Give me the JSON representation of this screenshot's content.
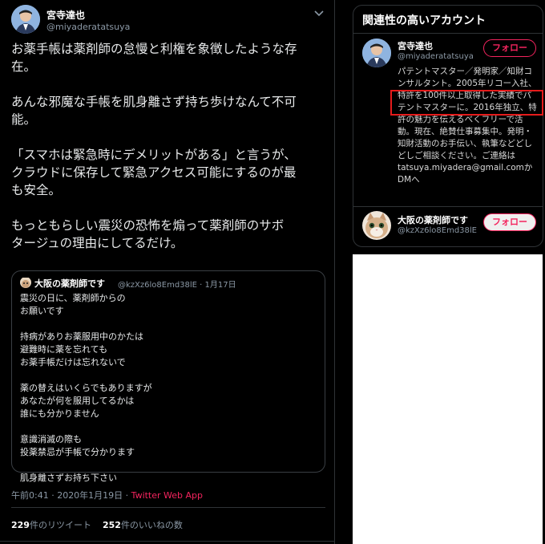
{
  "tweet": {
    "author_name": "宮寺達也",
    "author_handle": "@miyaderatatsuya",
    "paragraphs": [
      "お薬手帳は薬剤師の怠慢と利権を象徴したような存\n在。",
      "あんな邪魔な手帳を肌身離さず持ち歩けなんて不可\n能。",
      "「スマホは緊急時にデメリットがある」と言うが、\nクラウドに保存して緊急アクセス可能にするのが最\nも安全。",
      "もっともらしい震災の恐怖を煽って薬剤師のサボ\nタージュの理由にしてるだけ。"
    ],
    "timestamp": "午前0:41 · 2020年1月19日 · ",
    "source": "Twitter Web App",
    "retweets_count": "229",
    "retweets_label": "件のリツイート",
    "likes_count": "252",
    "likes_label": "件のいいねの数"
  },
  "quote": {
    "name": "大阪の薬剤師です",
    "handle_date": "@kzXz6lo8Emd38lE · 1月17日",
    "paragraphs": [
      "震災の日に、薬剤師からの\nお願いです",
      "持病がありお薬服用中のかたは\n避難時に薬を忘れても\nお薬手帳だけは忘れないで",
      "薬の替えはいくらでもありますが\nあなたが何を服用してるかは\n誰にも分かりません",
      "意識消滅の際も\n投薬禁忌が手帳で分かります",
      "肌身離さずお持ち下さい"
    ]
  },
  "related": {
    "title": "関連性の高いアカウント",
    "account1": {
      "name": "宮寺達也",
      "handle": "@miyaderatatsuya",
      "follow_label": "フォロー",
      "bio": "パテントマスター／発明家／知財コンサルタント。2005年リコー入社、特許を100件以上取得した実績でパテントマスターに。2016年独立、特許の魅力を伝えるべくフリーで活動。現在、絶賛仕事募集中。発明・知財活動のお手伝い、執筆などどしどしご相談ください。ご連絡は tatsuya.miyadera@gmail.comかDMへ"
    },
    "account2": {
      "name": "大阪の薬剤師です",
      "handle": "@kzXz6lo8Emd38lE",
      "follow_label": "フォロー"
    }
  },
  "colors": {
    "accent": "#f4245e",
    "highlight_box": "#e51b1b",
    "background": "#000000"
  },
  "icons": [
    "chevron-down-icon"
  ]
}
